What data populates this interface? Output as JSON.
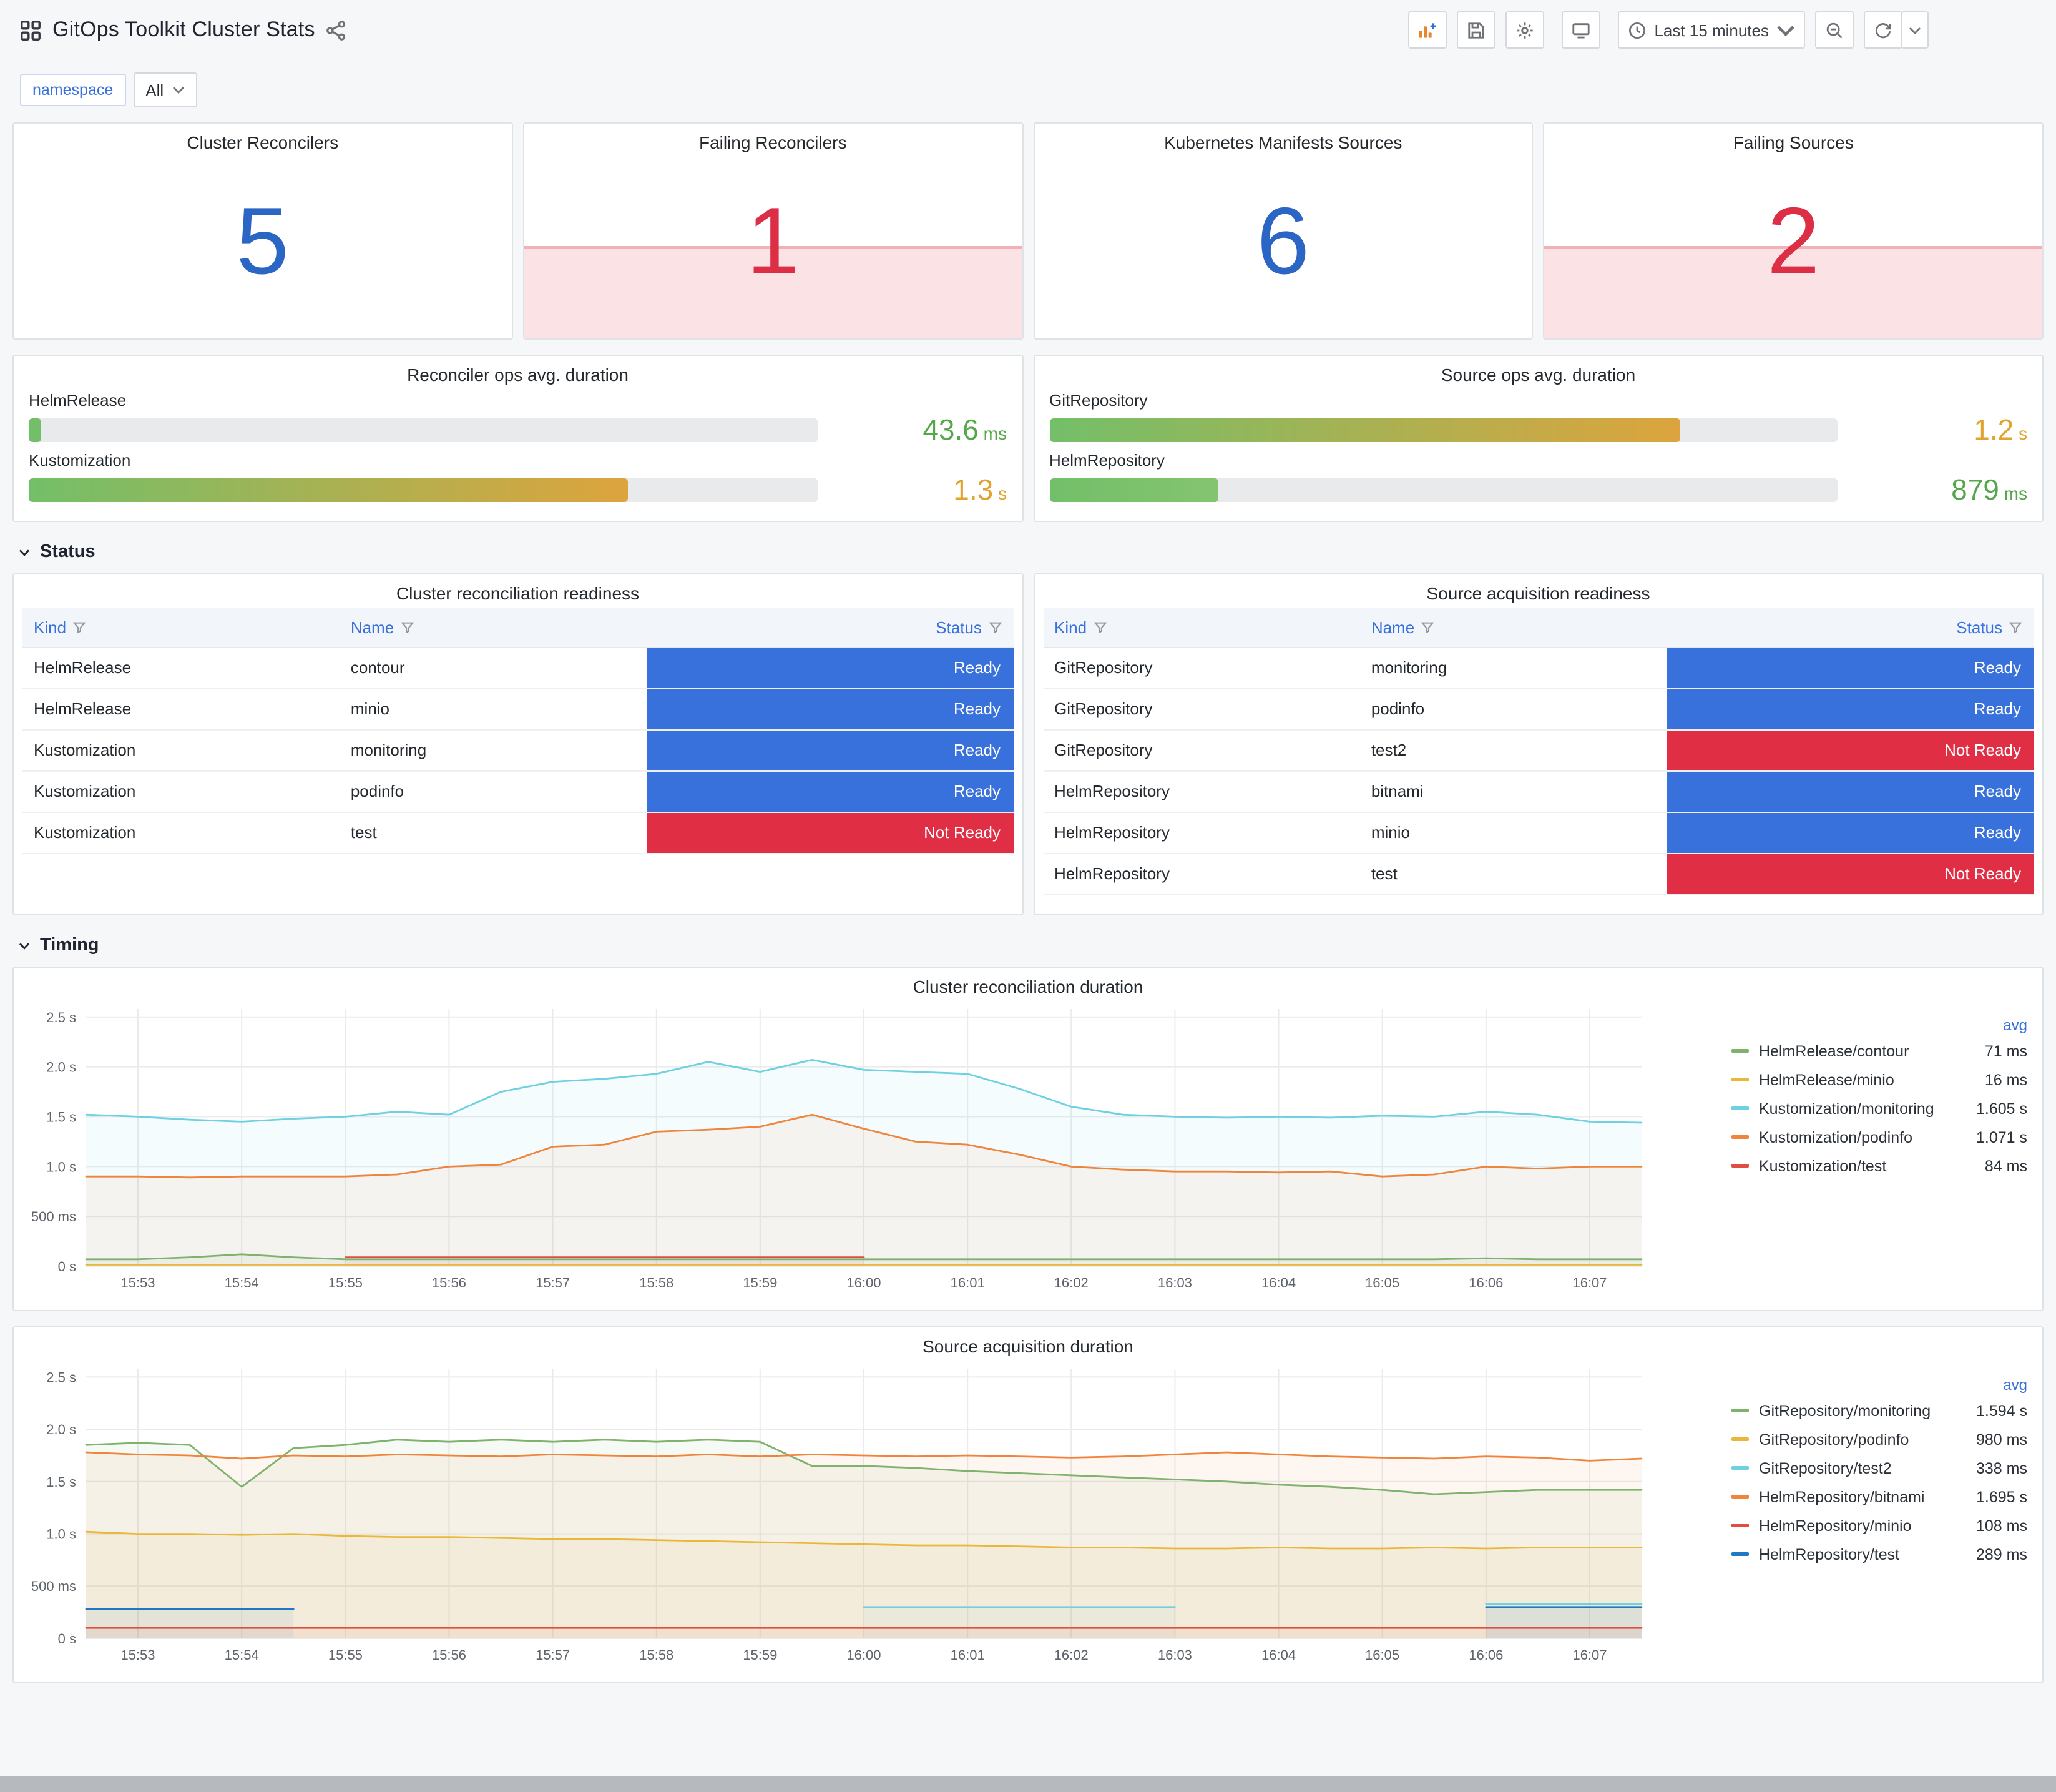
{
  "header": {
    "title": "GitOps Toolkit Cluster Stats",
    "time_range_label": "Last 15 minutes"
  },
  "variables": {
    "label": "namespace",
    "value": "All"
  },
  "section_titles": {
    "status": "Status",
    "timing": "Timing"
  },
  "colors": {
    "stat_blue": "#2b66c5",
    "stat_red": "#dc2f45",
    "status": {
      "Ready": "#3871dc",
      "Not Ready": "#e02f44"
    }
  },
  "stats": [
    {
      "title": "Cluster Reconcilers",
      "value": "5",
      "state": "ok"
    },
    {
      "title": "Failing Reconcilers",
      "value": "1",
      "state": "alert"
    },
    {
      "title": "Kubernetes Manifests Sources",
      "value": "6",
      "state": "ok"
    },
    {
      "title": "Failing Sources",
      "value": "2",
      "state": "alert"
    }
  ],
  "gauges": [
    {
      "title": "Reconciler ops avg. duration",
      "rows": [
        {
          "label": "HelmRelease",
          "value": "43.6",
          "unit": "ms",
          "value_color": "#56a64b",
          "fill_pct": 1.6,
          "fill_from": "#73bf69",
          "fill_to": "#73bf69"
        },
        {
          "label": "Kustomization",
          "value": "1.3",
          "unit": "s",
          "value_color": "#e0a32e",
          "fill_pct": 76,
          "fill_from": "#73bf69",
          "fill_to": "#dda43d"
        }
      ]
    },
    {
      "title": "Source ops avg. duration",
      "rows": [
        {
          "label": "GitRepository",
          "value": "1.2",
          "unit": "s",
          "value_color": "#e0a32e",
          "fill_pct": 80,
          "fill_from": "#73bf69",
          "fill_to": "#dda43d"
        },
        {
          "label": "HelmRepository",
          "value": "879",
          "unit": "ms",
          "value_color": "#56a64b",
          "fill_pct": 21.5,
          "fill_from": "#73bf69",
          "fill_to": "#84c470"
        }
      ]
    }
  ],
  "tables": [
    {
      "title": "Cluster reconciliation readiness",
      "columns": [
        "Kind",
        "Name",
        "Status"
      ],
      "rows": [
        [
          "HelmRelease",
          "contour",
          "Ready"
        ],
        [
          "HelmRelease",
          "minio",
          "Ready"
        ],
        [
          "Kustomization",
          "monitoring",
          "Ready"
        ],
        [
          "Kustomization",
          "podinfo",
          "Ready"
        ],
        [
          "Kustomization",
          "test",
          "Not Ready"
        ]
      ]
    },
    {
      "title": "Source acquisition readiness",
      "columns": [
        "Kind",
        "Name",
        "Status"
      ],
      "rows": [
        [
          "GitRepository",
          "monitoring",
          "Ready"
        ],
        [
          "GitRepository",
          "podinfo",
          "Ready"
        ],
        [
          "GitRepository",
          "test2",
          "Not Ready"
        ],
        [
          "HelmRepository",
          "bitnami",
          "Ready"
        ],
        [
          "HelmRepository",
          "minio",
          "Ready"
        ],
        [
          "HelmRepository",
          "test",
          "Not Ready"
        ]
      ]
    }
  ],
  "chart_data": [
    {
      "type": "line",
      "title": "Cluster reconciliation duration",
      "x_span_min": 15,
      "step_min": 0.5,
      "x_ticks": [
        {
          "v": 0.5,
          "label": "15:53"
        },
        {
          "v": 1.5,
          "label": "15:54"
        },
        {
          "v": 2.5,
          "label": "15:55"
        },
        {
          "v": 3.5,
          "label": "15:56"
        },
        {
          "v": 4.5,
          "label": "15:57"
        },
        {
          "v": 5.5,
          "label": "15:58"
        },
        {
          "v": 6.5,
          "label": "15:59"
        },
        {
          "v": 7.5,
          "label": "16:00"
        },
        {
          "v": 8.5,
          "label": "16:01"
        },
        {
          "v": 9.5,
          "label": "16:02"
        },
        {
          "v": 10.5,
          "label": "16:03"
        },
        {
          "v": 11.5,
          "label": "16:04"
        },
        {
          "v": 12.5,
          "label": "16:05"
        },
        {
          "v": 13.5,
          "label": "16:06"
        },
        {
          "v": 14.5,
          "label": "16:07"
        }
      ],
      "y_max": 2.58,
      "y_ticks": [
        {
          "v": 0,
          "label": "0 s"
        },
        {
          "v": 0.5,
          "label": "500 ms"
        },
        {
          "v": 1.0,
          "label": "1.0 s"
        },
        {
          "v": 1.5,
          "label": "1.5 s"
        },
        {
          "v": 2.0,
          "label": "2.0 s"
        },
        {
          "v": 2.5,
          "label": "2.5 s"
        }
      ],
      "legend_header": "avg",
      "series": [
        {
          "name": "HelmRelease/contour",
          "color": "#7EB26D",
          "avg": "71 ms",
          "values": [
            0.07,
            0.07,
            0.09,
            0.12,
            0.09,
            0.07,
            0.07,
            0.07,
            0.07,
            0.07,
            0.07,
            0.07,
            0.07,
            0.07,
            0.07,
            0.07,
            0.07,
            0.07,
            0.07,
            0.07,
            0.07,
            0.07,
            0.07,
            0.07,
            0.07,
            0.07,
            0.07,
            0.08,
            0.07,
            0.07,
            0.07
          ]
        },
        {
          "name": "HelmRelease/minio",
          "color": "#EAB839",
          "avg": "16 ms",
          "values": [
            0.016,
            0.016,
            0.016,
            0.016,
            0.016,
            0.016,
            0.016,
            0.016,
            0.016,
            0.016,
            0.016,
            0.016,
            0.016,
            0.016,
            0.016,
            0.016,
            0.016,
            0.016,
            0.016,
            0.016,
            0.016,
            0.016,
            0.016,
            0.016,
            0.016,
            0.016,
            0.016,
            0.016,
            0.016,
            0.016,
            0.016
          ]
        },
        {
          "name": "Kustomization/monitoring",
          "color": "#6ED0E0",
          "avg": "1.605 s",
          "values": [
            1.52,
            1.5,
            1.47,
            1.45,
            1.48,
            1.5,
            1.55,
            1.52,
            1.75,
            1.85,
            1.88,
            1.93,
            2.05,
            1.95,
            2.07,
            1.97,
            1.95,
            1.93,
            1.78,
            1.6,
            1.52,
            1.5,
            1.49,
            1.5,
            1.49,
            1.51,
            1.5,
            1.55,
            1.52,
            1.45,
            1.44
          ]
        },
        {
          "name": "Kustomization/podinfo",
          "color": "#EF843C",
          "avg": "1.071 s",
          "values": [
            0.9,
            0.9,
            0.89,
            0.9,
            0.9,
            0.9,
            0.92,
            1.0,
            1.02,
            1.2,
            1.22,
            1.35,
            1.37,
            1.4,
            1.52,
            1.38,
            1.25,
            1.22,
            1.12,
            1.0,
            0.97,
            0.95,
            0.95,
            0.94,
            0.95,
            0.9,
            0.92,
            1.0,
            0.98,
            1.0,
            1.0
          ]
        },
        {
          "name": "Kustomization/test",
          "color": "#E24D42",
          "avg": "84 ms",
          "values": [
            null,
            null,
            null,
            null,
            null,
            0.09,
            0.09,
            0.09,
            0.09,
            0.09,
            0.09,
            0.09,
            0.09,
            0.09,
            0.09,
            0.09,
            null,
            null,
            null,
            null,
            null,
            null,
            null,
            null,
            null,
            null,
            null,
            null,
            null,
            null,
            null
          ]
        }
      ]
    },
    {
      "type": "line",
      "title": "Source acquisition duration",
      "x_span_min": 15,
      "step_min": 0.5,
      "x_ticks": [
        {
          "v": 0.5,
          "label": "15:53"
        },
        {
          "v": 1.5,
          "label": "15:54"
        },
        {
          "v": 2.5,
          "label": "15:55"
        },
        {
          "v": 3.5,
          "label": "15:56"
        },
        {
          "v": 4.5,
          "label": "15:57"
        },
        {
          "v": 5.5,
          "label": "15:58"
        },
        {
          "v": 6.5,
          "label": "15:59"
        },
        {
          "v": 7.5,
          "label": "16:00"
        },
        {
          "v": 8.5,
          "label": "16:01"
        },
        {
          "v": 9.5,
          "label": "16:02"
        },
        {
          "v": 10.5,
          "label": "16:03"
        },
        {
          "v": 11.5,
          "label": "16:04"
        },
        {
          "v": 12.5,
          "label": "16:05"
        },
        {
          "v": 13.5,
          "label": "16:06"
        },
        {
          "v": 14.5,
          "label": "16:07"
        }
      ],
      "y_max": 2.58,
      "y_ticks": [
        {
          "v": 0,
          "label": "0 s"
        },
        {
          "v": 0.5,
          "label": "500 ms"
        },
        {
          "v": 1.0,
          "label": "1.0 s"
        },
        {
          "v": 1.5,
          "label": "1.5 s"
        },
        {
          "v": 2.0,
          "label": "2.0 s"
        },
        {
          "v": 2.5,
          "label": "2.5 s"
        }
      ],
      "legend_header": "avg",
      "series": [
        {
          "name": "GitRepository/monitoring",
          "color": "#7EB26D",
          "avg": "1.594 s",
          "values": [
            1.85,
            1.87,
            1.85,
            1.45,
            1.82,
            1.85,
            1.9,
            1.88,
            1.9,
            1.88,
            1.9,
            1.88,
            1.9,
            1.88,
            1.65,
            1.65,
            1.63,
            1.6,
            1.58,
            1.56,
            1.54,
            1.52,
            1.5,
            1.47,
            1.45,
            1.42,
            1.38,
            1.4,
            1.42,
            1.42,
            1.42
          ]
        },
        {
          "name": "GitRepository/podinfo",
          "color": "#EAB839",
          "avg": "980 ms",
          "values": [
            1.02,
            1.0,
            1.0,
            0.99,
            1.0,
            0.98,
            0.97,
            0.97,
            0.96,
            0.95,
            0.95,
            0.94,
            0.93,
            0.92,
            0.91,
            0.9,
            0.89,
            0.89,
            0.88,
            0.87,
            0.87,
            0.86,
            0.86,
            0.87,
            0.86,
            0.86,
            0.87,
            0.86,
            0.87,
            0.87,
            0.87
          ]
        },
        {
          "name": "GitRepository/test2",
          "color": "#6ED0E0",
          "avg": "338 ms",
          "values": [
            null,
            null,
            null,
            null,
            null,
            null,
            null,
            null,
            null,
            null,
            null,
            null,
            null,
            null,
            null,
            0.3,
            0.3,
            0.3,
            0.3,
            0.3,
            0.3,
            0.3,
            null,
            null,
            null,
            null,
            null,
            0.33,
            0.33,
            0.33,
            0.33
          ]
        },
        {
          "name": "HelmRepository/bitnami",
          "color": "#EF843C",
          "avg": "1.695 s",
          "values": [
            1.78,
            1.76,
            1.75,
            1.72,
            1.75,
            1.74,
            1.76,
            1.75,
            1.74,
            1.76,
            1.75,
            1.74,
            1.76,
            1.74,
            1.76,
            1.75,
            1.74,
            1.75,
            1.74,
            1.73,
            1.74,
            1.76,
            1.78,
            1.76,
            1.74,
            1.73,
            1.72,
            1.74,
            1.73,
            1.7,
            1.72
          ]
        },
        {
          "name": "HelmRepository/minio",
          "color": "#E24D42",
          "avg": "108 ms",
          "values": [
            0.1,
            0.1,
            0.1,
            0.1,
            0.1,
            0.1,
            0.1,
            0.1,
            0.1,
            0.1,
            0.1,
            0.1,
            0.1,
            0.1,
            0.1,
            0.1,
            0.1,
            0.1,
            0.1,
            0.1,
            0.1,
            0.1,
            0.1,
            0.1,
            0.1,
            0.1,
            0.1,
            0.1,
            0.1,
            0.1,
            0.1
          ]
        },
        {
          "name": "HelmRepository/test",
          "color": "#1F78C1",
          "avg": "289 ms",
          "values": [
            0.28,
            0.28,
            0.28,
            0.28,
            0.28,
            null,
            null,
            null,
            null,
            null,
            null,
            null,
            null,
            null,
            null,
            null,
            null,
            null,
            null,
            null,
            null,
            null,
            null,
            null,
            null,
            null,
            null,
            0.3,
            0.3,
            0.3,
            0.3
          ]
        }
      ]
    }
  ]
}
